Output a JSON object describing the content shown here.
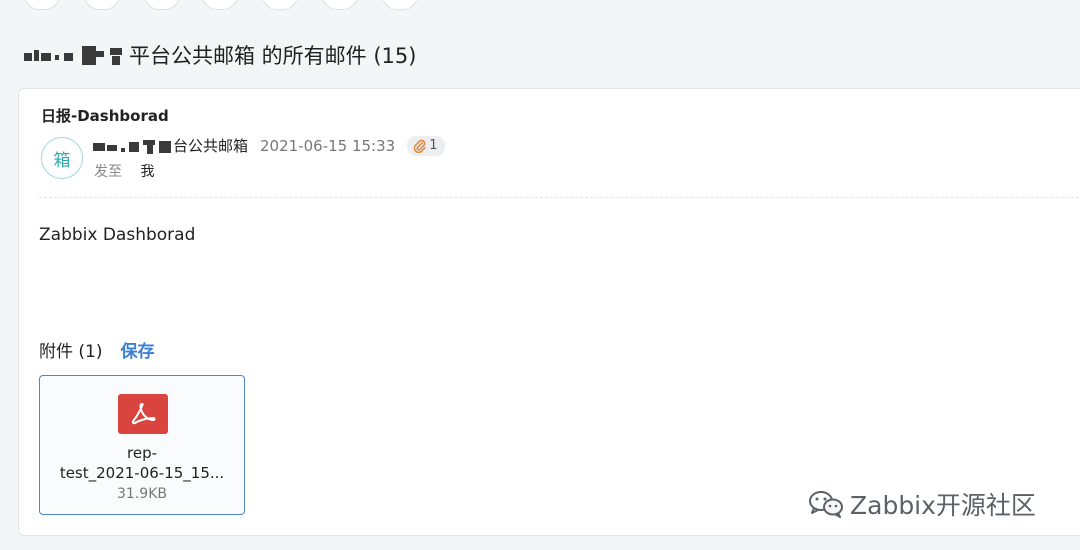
{
  "page": {
    "title_suffix": "平台公共邮箱 的所有邮件 (15)"
  },
  "mail": {
    "subject": "日报-Dashborad",
    "avatar_char": "箱",
    "sender_suffix": "台公共邮箱",
    "date": "2021-06-15 15:33",
    "attachment_count": "1",
    "to_label": "发至",
    "to_value": "我",
    "body": "Zabbix Dashborad"
  },
  "attachments": {
    "header": "附件 (1)",
    "save_label": "保存",
    "files": [
      {
        "name_line1": "rep-",
        "name_line2": "test_2021-06-15_15...",
        "size": "31.9KB",
        "icon": "pdf-icon"
      }
    ]
  },
  "watermark": {
    "text": "Zabbix开源社区",
    "icon": "wechat-icon"
  },
  "colors": {
    "accent": "#3b7fd1",
    "pdf": "#d9443e",
    "avatar": "#31a9b0"
  }
}
